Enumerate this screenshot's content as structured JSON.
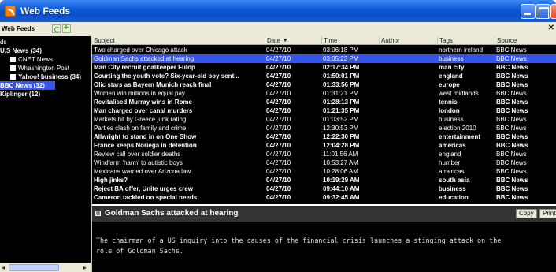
{
  "window": {
    "title": "Web Feeds"
  },
  "toolbar": {
    "label": "Web Feeds",
    "close_glyph": "✕"
  },
  "sidebar": {
    "items": [
      {
        "label": "ds",
        "bold": false,
        "selected": false,
        "indent": 0,
        "icon": false
      },
      {
        "label": "U.S News (34)",
        "bold": true,
        "selected": false,
        "indent": 0,
        "icon": false
      },
      {
        "label": "CNET News",
        "bold": false,
        "selected": false,
        "indent": 13,
        "icon": true
      },
      {
        "label": "Whashington Post",
        "bold": false,
        "selected": false,
        "indent": 13,
        "icon": true
      },
      {
        "label": "Yahoo! business (34)",
        "bold": true,
        "selected": false,
        "indent": 13,
        "icon": true
      },
      {
        "label": "BBC News (32)",
        "bold": true,
        "selected": true,
        "indent": 0,
        "icon": false
      },
      {
        "label": "Kiplinger (12)",
        "bold": true,
        "selected": false,
        "indent": 0,
        "icon": false
      }
    ]
  },
  "list": {
    "columns": [
      "Subject",
      "Date",
      "Time",
      "Author",
      "Tags",
      "Source"
    ],
    "rows": [
      {
        "subject": "Two charged over Chicago attack",
        "date": "04/27/10",
        "time": "03:06:18 PM",
        "author": "",
        "tags": "northern ireland",
        "source": "BBC News",
        "unread": false,
        "selected": false
      },
      {
        "subject": "Goldman Sachs attacked at hearing",
        "date": "04/27/10",
        "time": "03:05:23 PM",
        "author": "",
        "tags": "business",
        "source": "BBC News",
        "unread": false,
        "selected": true
      },
      {
        "subject": "Man City recruit goalkeeper Fulop",
        "date": "04/27/10",
        "time": "02:17:34 PM",
        "author": "",
        "tags": "man city",
        "source": "BBC News",
        "unread": true,
        "selected": false
      },
      {
        "subject": "Courting the youth vote? Six-year-old boy sent...",
        "date": "04/27/10",
        "time": "01:50:01 PM",
        "author": "",
        "tags": "england",
        "source": "BBC News",
        "unread": true,
        "selected": false
      },
      {
        "subject": "Olic stars as Bayern Munich reach final",
        "date": "04/27/10",
        "time": "01:33:56 PM",
        "author": "",
        "tags": "europe",
        "source": "BBC News",
        "unread": true,
        "selected": false
      },
      {
        "subject": "Women win millions in equal pay",
        "date": "04/27/10",
        "time": "01:31:21 PM",
        "author": "",
        "tags": "west midlands",
        "source": "BBC News",
        "unread": false,
        "selected": false
      },
      {
        "subject": "Revitalised Murray wins in Rome",
        "date": "04/27/10",
        "time": "01:28:13 PM",
        "author": "",
        "tags": "tennis",
        "source": "BBC News",
        "unread": true,
        "selected": false
      },
      {
        "subject": "Man charged over canal murders",
        "date": "04/27/10",
        "time": "01:21:35 PM",
        "author": "",
        "tags": "london",
        "source": "BBC News",
        "unread": true,
        "selected": false
      },
      {
        "subject": "Markets hit by Greece junk rating",
        "date": "04/27/10",
        "time": "01:03:52 PM",
        "author": "",
        "tags": "business",
        "source": "BBC News",
        "unread": false,
        "selected": false
      },
      {
        "subject": "Parties clash on family and crime",
        "date": "04/27/10",
        "time": "12:30:53 PM",
        "author": "",
        "tags": "election 2010",
        "source": "BBC News",
        "unread": false,
        "selected": false
      },
      {
        "subject": "Allwright to stand in on One Show",
        "date": "04/27/10",
        "time": "12:22:30 PM",
        "author": "",
        "tags": "entertainment",
        "source": "BBC News",
        "unread": true,
        "selected": false
      },
      {
        "subject": "France keeps Noriega in detention",
        "date": "04/27/10",
        "time": "12:04:28 PM",
        "author": "",
        "tags": "americas",
        "source": "BBC News",
        "unread": true,
        "selected": false
      },
      {
        "subject": "Review call over soldier deaths",
        "date": "04/27/10",
        "time": "11:01:56 AM",
        "author": "",
        "tags": "england",
        "source": "BBC News",
        "unread": false,
        "selected": false
      },
      {
        "subject": "Windfarm 'harm' to autistic boys",
        "date": "04/27/10",
        "time": "10:53:27 AM",
        "author": "",
        "tags": "humber",
        "source": "BBC News",
        "unread": false,
        "selected": false
      },
      {
        "subject": "Mexicans warned over Arizona law",
        "date": "04/27/10",
        "time": "10:28:06 AM",
        "author": "",
        "tags": "americas",
        "source": "BBC News",
        "unread": false,
        "selected": false
      },
      {
        "subject": "High jinks?",
        "date": "04/27/10",
        "time": "10:19:29 AM",
        "author": "",
        "tags": "south asia",
        "source": "BBC News",
        "unread": true,
        "selected": false
      },
      {
        "subject": "Reject BA offer, Unite urges crew",
        "date": "04/27/10",
        "time": "09:44:10 AM",
        "author": "",
        "tags": "business",
        "source": "BBC News",
        "unread": true,
        "selected": false
      },
      {
        "subject": "Cameron tackled on special needs",
        "date": "04/27/10",
        "time": "09:32:45 AM",
        "author": "",
        "tags": "education",
        "source": "BBC News",
        "unread": true,
        "selected": false
      }
    ]
  },
  "preview": {
    "title": "Goldman Sachs attacked at hearing",
    "copy_label": "Copy",
    "print_label": "Print",
    "body_line1": "The chairman of a US inquiry into the causes of the financial crisis launches a stinging attack on the",
    "body_line2": "role of Goldman Sachs."
  },
  "scrollbar": {
    "left_arrow": "◂",
    "right_arrow": "▸"
  },
  "colors": {
    "selection": "#3355ee",
    "titlebar": "#0b58d8",
    "background": "#000000"
  }
}
